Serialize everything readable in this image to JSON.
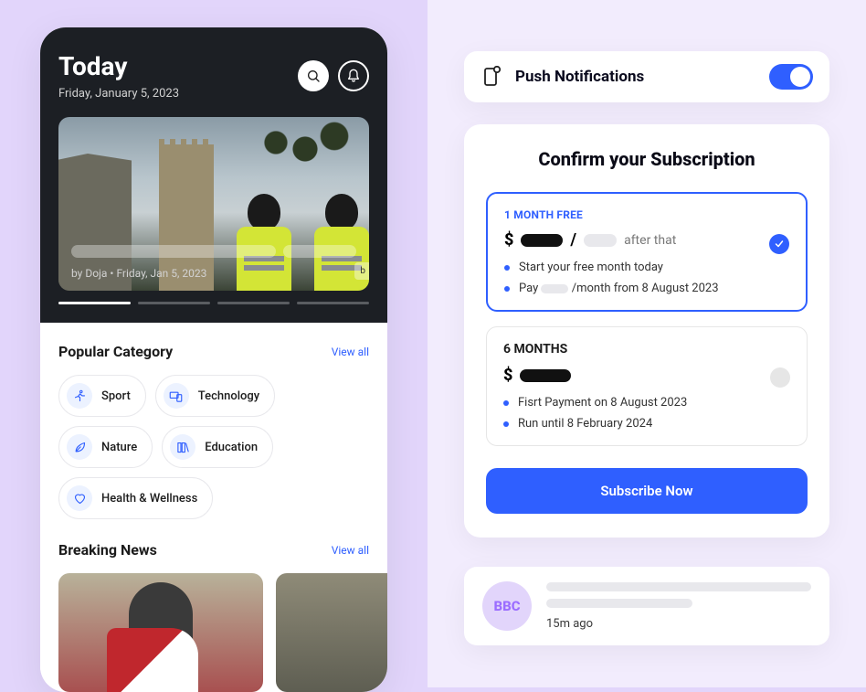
{
  "phone": {
    "header": {
      "title": "Today",
      "date": "Friday, January 5, 2023"
    },
    "hero": {
      "author_line": "by Doja  •  Friday, Jan 5, 2023",
      "next_chip": "b"
    },
    "popular": {
      "title": "Popular Category",
      "view_all": "View all",
      "chips": [
        "Sport",
        "Technology",
        "Nature",
        "Education",
        "Health & Wellness"
      ]
    },
    "breaking": {
      "title": "Breaking News",
      "view_all": "View all"
    }
  },
  "push": {
    "label": "Push Notifications",
    "enabled": true
  },
  "subscription": {
    "title": "Confirm your Subscription",
    "plans": [
      {
        "badge": "1 MONTH FREE",
        "after_that": "after that",
        "bullets": [
          "Start your free month today",
          "Pay ___ /month from 8 August 2023"
        ],
        "selected": true
      },
      {
        "name": "6 MONTHS",
        "bullets": [
          "Fisrt Payment on 8 August 2023",
          "Run until 8 February 2024"
        ],
        "selected": false
      }
    ],
    "cta": "Subscribe Now"
  },
  "feed": {
    "avatar_label": "BBC",
    "time": "15m ago"
  }
}
